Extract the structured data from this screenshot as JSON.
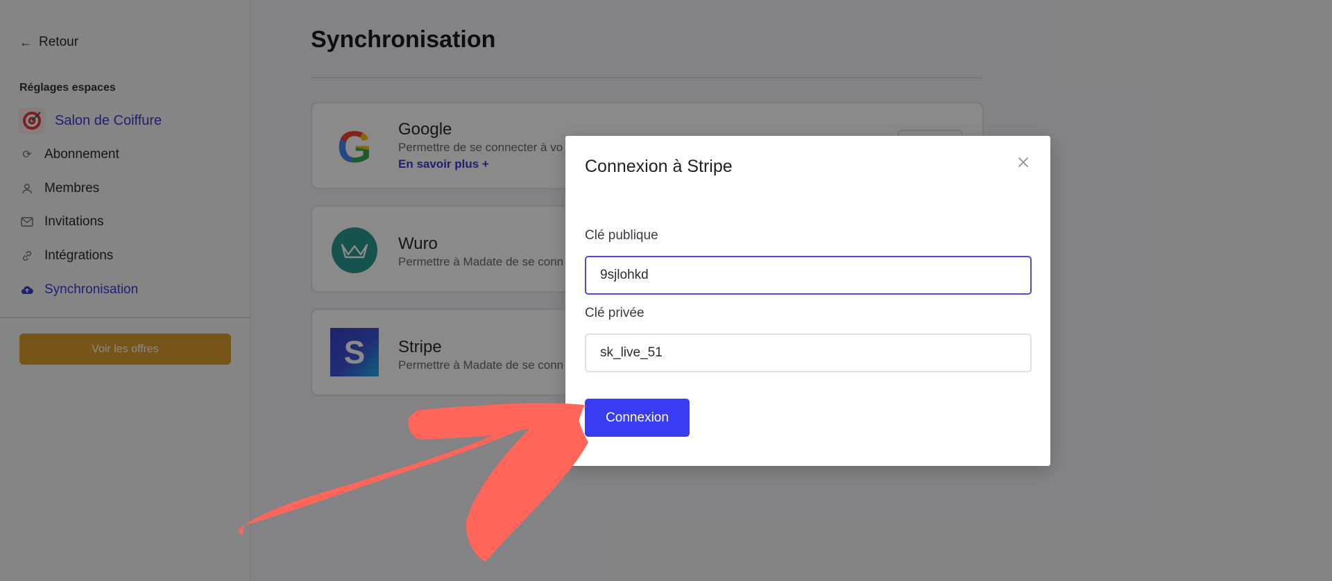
{
  "sidebar": {
    "back_label": "Retour",
    "section_title": "Réglages espaces",
    "space_name": "Salon de Coiffure",
    "items": [
      {
        "label": "Abonnement",
        "icon": "refresh-icon"
      },
      {
        "label": "Membres",
        "icon": "user-icon"
      },
      {
        "label": "Invitations",
        "icon": "mail-icon"
      },
      {
        "label": "Intégrations",
        "icon": "link-icon"
      },
      {
        "label": "Synchronisation",
        "icon": "cloud-upload-icon",
        "active": true
      }
    ],
    "offers_button": "Voir les offres"
  },
  "main": {
    "title": "Synchronisation",
    "integrations": [
      {
        "name": "Google",
        "description": "Permettre de se connecter à vo",
        "more_link": "En savoir plus +"
      },
      {
        "name": "Wuro",
        "description": "Permettre à Madate de se conn"
      },
      {
        "name": "Stripe",
        "description": "Permettre à Madate de se conn",
        "logo_letter": "S"
      }
    ]
  },
  "modal": {
    "title": "Connexion à Stripe",
    "public_key_label": "Clé publique",
    "public_key_value": "9sjlohkd",
    "private_key_label": "Clé privée",
    "private_key_value": "sk_live_51",
    "submit_label": "Connexion"
  },
  "colors": {
    "accent": "#3a3cf4",
    "offers": "#dc9b2c",
    "annotation_arrow": "#ff6659"
  }
}
